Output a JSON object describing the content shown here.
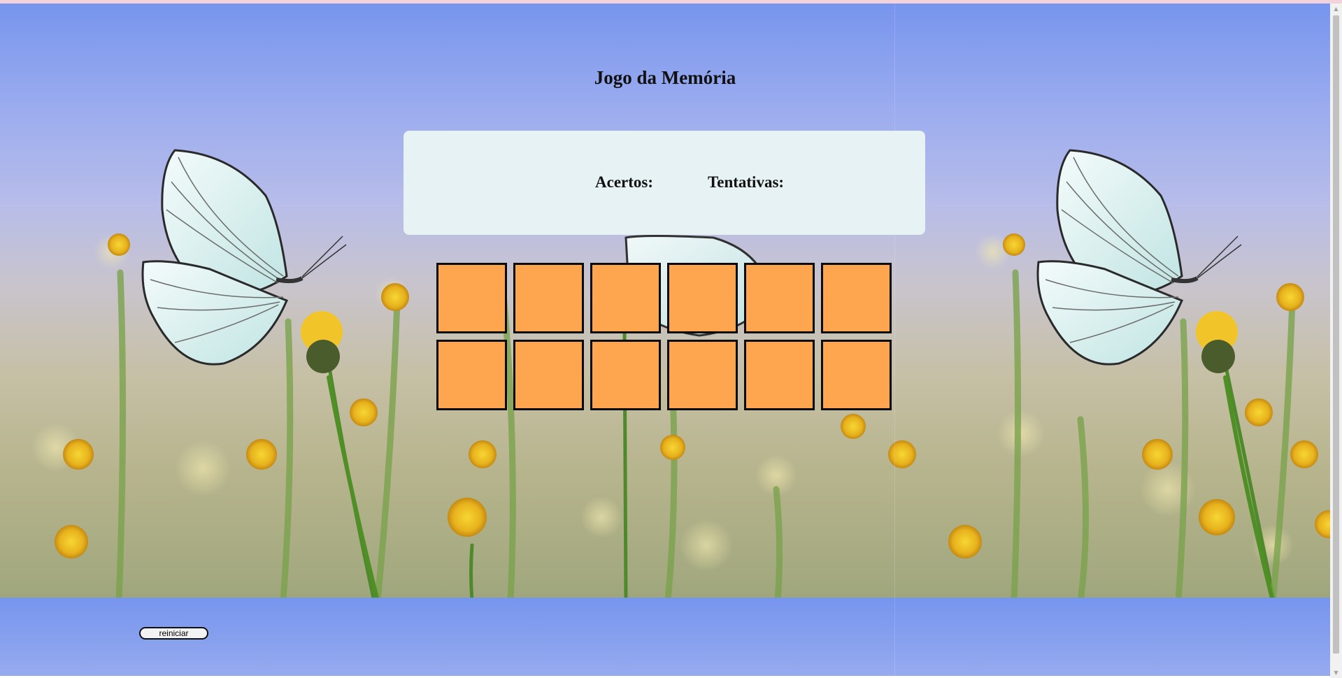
{
  "game": {
    "title": "Jogo da Memória",
    "score": {
      "hits_label": "Acertos:",
      "attempts_label": "Tentativas:"
    },
    "cards": [
      {
        "state": "face-down"
      },
      {
        "state": "face-down"
      },
      {
        "state": "face-down"
      },
      {
        "state": "face-down"
      },
      {
        "state": "face-down"
      },
      {
        "state": "face-down"
      },
      {
        "state": "face-down"
      },
      {
        "state": "face-down"
      },
      {
        "state": "face-down"
      },
      {
        "state": "face-down"
      },
      {
        "state": "face-down"
      },
      {
        "state": "face-down"
      }
    ],
    "restart_label": "reiniciar"
  },
  "background": {
    "image": "butterfly-meadow-photo"
  },
  "colors": {
    "card_back": "#fea54f",
    "panel": "#e6f2f4",
    "sky": "#7695ee"
  }
}
